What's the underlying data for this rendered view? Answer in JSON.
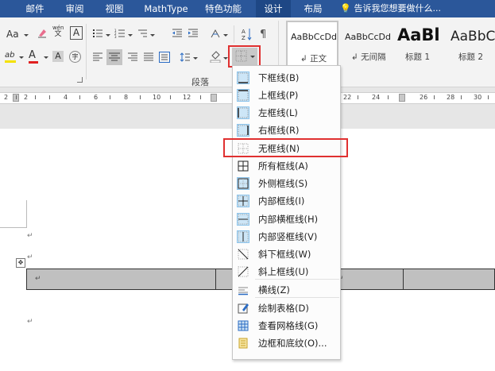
{
  "tabs": [
    "邮件",
    "审阅",
    "视图",
    "MathType",
    "特色功能",
    "设计",
    "布局"
  ],
  "search": {
    "placeholder": "告诉我您想要做什么..."
  },
  "ribbon": {
    "font_size_label": "Aa",
    "phonetic_label": "wén",
    "clear_format_label": "A",
    "highlight_label": "ab",
    "font_color_label": "A",
    "char_shading_label": "A",
    "enclose_label": "字",
    "styles_dialog_hint": "",
    "group_label": "段落",
    "styles": [
      {
        "sample": "AaBbCcDd",
        "label": "正文"
      },
      {
        "sample": "AaBbCcDd",
        "label": "无间隔"
      },
      {
        "sample": "AaBl",
        "label": "标题 1"
      },
      {
        "sample": "AaBbC",
        "label": "标题 2"
      }
    ]
  },
  "ruler_numbers": [
    "2",
    "2",
    "4",
    "6",
    "8",
    "10",
    "12",
    "22",
    "24",
    "26",
    "28",
    "30",
    "32"
  ],
  "menu": {
    "items": [
      {
        "label": "下框线(B)",
        "icon": "bottom-border-icon"
      },
      {
        "label": "上框线(P)",
        "icon": "top-border-icon"
      },
      {
        "label": "左框线(L)",
        "icon": "left-border-icon"
      },
      {
        "label": "右框线(R)",
        "icon": "right-border-icon"
      },
      {
        "label": "无框线(N)",
        "icon": "no-border-icon"
      },
      {
        "label": "所有框线(A)",
        "icon": "all-borders-icon"
      },
      {
        "label": "外侧框线(S)",
        "icon": "outside-borders-icon"
      },
      {
        "label": "内部框线(I)",
        "icon": "inside-borders-icon"
      },
      {
        "label": "内部横框线(H)",
        "icon": "inside-horizontal-border-icon"
      },
      {
        "label": "内部竖框线(V)",
        "icon": "inside-vertical-border-icon"
      },
      {
        "label": "斜下框线(W)",
        "icon": "diagonal-down-border-icon"
      },
      {
        "label": "斜上框线(U)",
        "icon": "diagonal-up-border-icon"
      },
      {
        "label": "横线(Z)",
        "icon": "horizontal-line-icon"
      },
      {
        "label": "绘制表格(D)",
        "icon": "draw-table-icon"
      },
      {
        "label": "查看网格线(G)",
        "icon": "view-gridlines-icon"
      },
      {
        "label": "边框和底纹(O)...",
        "icon": "borders-shading-icon"
      }
    ]
  },
  "document": {
    "return_mark": "↵",
    "move_handle": "✥"
  },
  "colors": {
    "tab_blue": "#2b579a",
    "highlight_red": "#e03030",
    "table_gray": "#c0c0c0"
  }
}
